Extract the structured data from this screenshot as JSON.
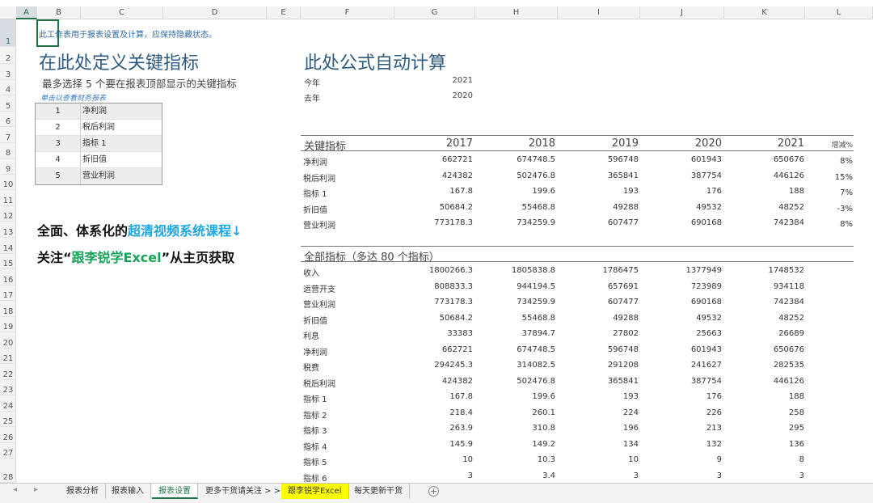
{
  "columns": [
    "A",
    "B",
    "C",
    "D",
    "E",
    "F",
    "G",
    "H",
    "I",
    "J",
    "K",
    "L"
  ],
  "rows": [
    "1",
    "2",
    "3",
    "4",
    "5",
    "6",
    "7",
    "8",
    "9",
    "10",
    "11",
    "12",
    "13",
    "14",
    "15",
    "16",
    "17",
    "18",
    "19",
    "20",
    "21",
    "22",
    "23",
    "24",
    "25",
    "26",
    "27",
    "28"
  ],
  "left": {
    "note": "此工作表用于报表设置及计算，应保持隐藏状态。",
    "title": "在此处定义关键指标",
    "subtitle": "最多选择 5 个要在报表顶部显示的关键指标",
    "link": "单击以查看财务报表",
    "selection": [
      {
        "n": "1",
        "v": "净利润"
      },
      {
        "n": "2",
        "v": "税后利润"
      },
      {
        "n": "3",
        "v": "指标 1"
      },
      {
        "n": "4",
        "v": "折旧值"
      },
      {
        "n": "5",
        "v": "营业利润"
      }
    ],
    "promo1_pre": "全面、体系化的",
    "promo1_hl": "超清视频系统课程↓",
    "promo2_pre": "关注“",
    "promo2_hl": "跟李锐学Excel",
    "promo2_post": "”从主页获取"
  },
  "right": {
    "title": "此处公式自动计算",
    "this_year_label": "今年",
    "this_year": "2021",
    "last_year_label": "去年",
    "last_year": "2020",
    "key_header": "关键指标",
    "all_header": "全部指标（多达 80 个指标）",
    "years": [
      "2017",
      "2018",
      "2019",
      "2020",
      "2021"
    ],
    "increase_label": "增减%",
    "key_rows": [
      {
        "label": "净利润",
        "vals": [
          "662721",
          "674748.5",
          "596748",
          "601943",
          "650676"
        ],
        "pct": "8%"
      },
      {
        "label": "税后利润",
        "vals": [
          "424382",
          "502476.8",
          "365841",
          "387754",
          "446126"
        ],
        "pct": "15%"
      },
      {
        "label": "指标 1",
        "vals": [
          "167.8",
          "199.6",
          "193",
          "176",
          "188"
        ],
        "pct": "7%"
      },
      {
        "label": "折旧值",
        "vals": [
          "50684.2",
          "55468.8",
          "49288",
          "49532",
          "48252"
        ],
        "pct": "-3%"
      },
      {
        "label": "营业利润",
        "vals": [
          "773178.3",
          "734259.9",
          "607477",
          "690168",
          "742384"
        ],
        "pct": "8%"
      }
    ],
    "all_rows": [
      {
        "label": "收入",
        "vals": [
          "1800266.3",
          "1805838.8",
          "1786475",
          "1377949",
          "1748532"
        ]
      },
      {
        "label": "运营开支",
        "vals": [
          "808833.3",
          "944194.5",
          "657691",
          "723989",
          "934118"
        ]
      },
      {
        "label": "营业利润",
        "vals": [
          "773178.3",
          "734259.9",
          "607477",
          "690168",
          "742384"
        ]
      },
      {
        "label": "折旧值",
        "vals": [
          "50684.2",
          "55468.8",
          "49288",
          "49532",
          "48252"
        ]
      },
      {
        "label": "利息",
        "vals": [
          "33383",
          "37894.7",
          "27802",
          "25663",
          "26689"
        ]
      },
      {
        "label": "净利润",
        "vals": [
          "662721",
          "674748.5",
          "596748",
          "601943",
          "650676"
        ]
      },
      {
        "label": "税费",
        "vals": [
          "294245.3",
          "314082.5",
          "291208",
          "241627",
          "282535"
        ]
      },
      {
        "label": "税后利润",
        "vals": [
          "424382",
          "502476.8",
          "365841",
          "387754",
          "446126"
        ]
      },
      {
        "label": "指标 1",
        "vals": [
          "167.8",
          "199.6",
          "193",
          "176",
          "188"
        ]
      },
      {
        "label": "指标 2",
        "vals": [
          "218.4",
          "260.1",
          "224",
          "226",
          "258"
        ]
      },
      {
        "label": "指标 3",
        "vals": [
          "263.9",
          "310.8",
          "196",
          "213",
          "295"
        ]
      },
      {
        "label": "指标 4",
        "vals": [
          "145.9",
          "149.2",
          "134",
          "132",
          "136"
        ]
      },
      {
        "label": "指标 5",
        "vals": [
          "10",
          "10.3",
          "10",
          "9",
          "8"
        ]
      },
      {
        "label": "指标 6",
        "vals": [
          "3",
          "3.4",
          "3",
          "3",
          "3"
        ]
      }
    ]
  },
  "tabs": [
    {
      "label": "报表分析",
      "state": "normal"
    },
    {
      "label": "报表输入",
      "state": "normal"
    },
    {
      "label": "报表设置",
      "state": "active"
    },
    {
      "label": "更多干货请关注 > >",
      "state": "normal"
    },
    {
      "label": "跟李锐学Excel",
      "state": "yellow"
    },
    {
      "label": "每天更新干货",
      "state": "normal"
    }
  ],
  "nav_prev": "◂",
  "nav_next": "▸",
  "add_sheet": "+",
  "colors": {
    "accent": "#217346",
    "title": "#2e5a80",
    "promo_blue": "#1ea7e0",
    "promo_green": "#1aa35a",
    "tab_yellow": "#ffff00"
  }
}
